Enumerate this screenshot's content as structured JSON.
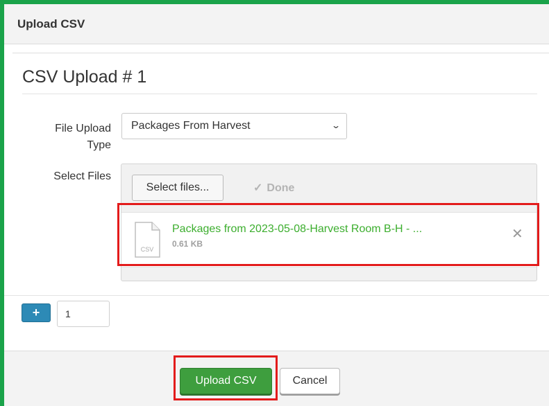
{
  "modal": {
    "title": "Upload CSV"
  },
  "form": {
    "heading": "CSV Upload # 1",
    "file_upload_type_label": "File Upload Type",
    "file_upload_type_value": "Packages From Harvest",
    "select_files_label": "Select Files"
  },
  "uploader": {
    "select_files_button": "Select files...",
    "done_label": "Done",
    "file": {
      "name": "Packages from 2023-05-08-Harvest Room B-H - ...",
      "size": "0.61 KB",
      "icon": "csv-file-icon",
      "icon_text": "CSV"
    }
  },
  "counter": {
    "value": "1",
    "plus_label": "+"
  },
  "footer": {
    "upload_label": "Upload CSV",
    "cancel_label": "Cancel"
  },
  "colors": {
    "frame_green": "#1aa34a",
    "highlight_red": "#e31b1b",
    "file_name_green": "#3cae2e",
    "upload_button_green": "#3e9e3e",
    "plus_button_blue": "#2d8ab6"
  }
}
